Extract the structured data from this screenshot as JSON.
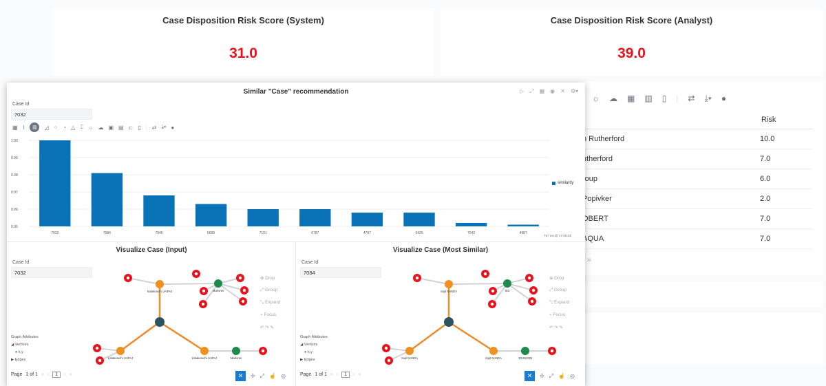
{
  "kpi_system": {
    "title": "Case Disposition Risk Score (System)",
    "value": "31.0"
  },
  "kpi_analyst": {
    "title": "Case Disposition Risk Score (Analyst)",
    "value": "39.0"
  },
  "risk_table": {
    "header": {
      "name": "",
      "risk": "Risk"
    },
    "rows": [
      {
        "name": "n Rutherford",
        "risk": "10.0"
      },
      {
        "name": "utherford",
        "risk": "7.0"
      },
      {
        "name": "roup",
        "risk": "6.0"
      },
      {
        "name": "Popivker",
        "risk": "2.0"
      },
      {
        "name": "OBERT",
        "risk": "7.0"
      },
      {
        "name": "AQUA",
        "risk": "7.0"
      }
    ],
    "pager": "› »"
  },
  "recommendation": {
    "title": "Similar \"Case\" recommendation",
    "case_id_label": "Case Id",
    "case_id_value": "7032",
    "legend": "similarity",
    "footnote": "757 ms @ 17:06:23"
  },
  "chart_data": {
    "type": "bar",
    "title": "Similar \"Case\" recommendation",
    "categories": [
      "7032",
      "7084",
      "7046",
      "6699",
      "7101",
      "6787",
      "4707",
      "6420",
      "7042",
      "4987"
    ],
    "series": [
      {
        "name": "similarity",
        "values": [
          1.0,
          0.981,
          0.968,
          0.963,
          0.96,
          0.96,
          0.958,
          0.958,
          0.952,
          0.951
        ]
      }
    ],
    "yticks": [
      "0.95",
      "0.96",
      "0.97",
      "0.98",
      "0.99",
      "1.00"
    ],
    "ylim": [
      0.95,
      1.0
    ],
    "color": "#0a73b8",
    "grid": true,
    "legend_position": "right"
  },
  "graph_left": {
    "title": "Visualize Case (Input)",
    "case_id_label": "Case Id",
    "case_id_value": "7032",
    "nodes": {
      "top": "Kalakuruchi JAIPAJ",
      "right_top": "Marlores",
      "bottom_left": "Kalakuruchi JAIPAJ",
      "bottom_mid": "Kalakuruchi JAIPAJ",
      "bottom_right": "Marlores"
    }
  },
  "graph_right": {
    "title": "Visualize Case (Most Similar)",
    "case_id_label": "Case Id",
    "case_id_value": "7084",
    "nodes": {
      "top": "Sujit NANDA",
      "right_top": "SID",
      "bottom_left": "Sujit NANDA",
      "bottom_mid": "Sujit NANDA",
      "bottom_right": "JOHNSON"
    }
  },
  "graph_controls": {
    "drop": "Drop",
    "group": "Group",
    "expand": "Expand",
    "focus": "Focus"
  },
  "graph_attributes": {
    "title": "Graph Attributes",
    "vertices": "Vertices",
    "key": "k,y",
    "edges": "Edges"
  },
  "pager": {
    "page_label": "Page",
    "page_of": "1 of 1",
    "current": "1"
  },
  "colors": {
    "bar": "#0a73b8",
    "kpi": "#e8121b",
    "node_orange": "#f0901e",
    "node_green": "#1e8a4c",
    "node_dark": "#2c5360",
    "node_red": "#e8121b",
    "edge_orange": "#ef8a2b"
  }
}
